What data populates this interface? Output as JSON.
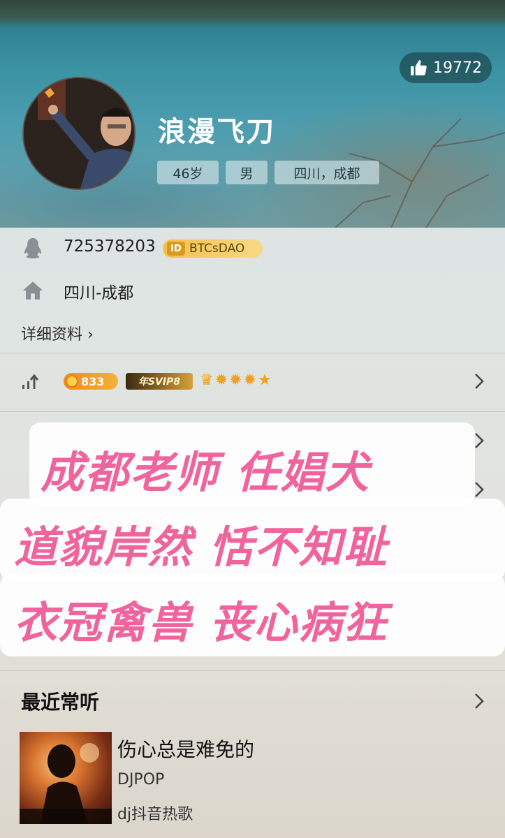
{
  "profile": {
    "likes": "19772",
    "nickname": "浪漫飞刀",
    "tags": [
      "46岁",
      "男",
      "四川，成都"
    ]
  },
  "info": {
    "qq_number": "725378203",
    "id_badge": "BTCsDAO",
    "id_mark": "ID",
    "location": "四川-成都",
    "details_link": "详细资料 ›"
  },
  "level": {
    "coins": "833",
    "svip": "年SVIP8"
  },
  "overlay": {
    "line1": "成都老师 任娼犬",
    "line2": "道貌岸然 恬不知耻",
    "line3": "衣冠禽兽 丧心病狂"
  },
  "recent": {
    "title": "最近常听",
    "song_title": "伤心总是难免的",
    "artist": "DJPOP",
    "album": "dj抖音热歌"
  },
  "colors": {
    "overlay_text": "#f0649e",
    "coin_orange": "#f28a1d",
    "id_gold": "#f4c04a"
  }
}
